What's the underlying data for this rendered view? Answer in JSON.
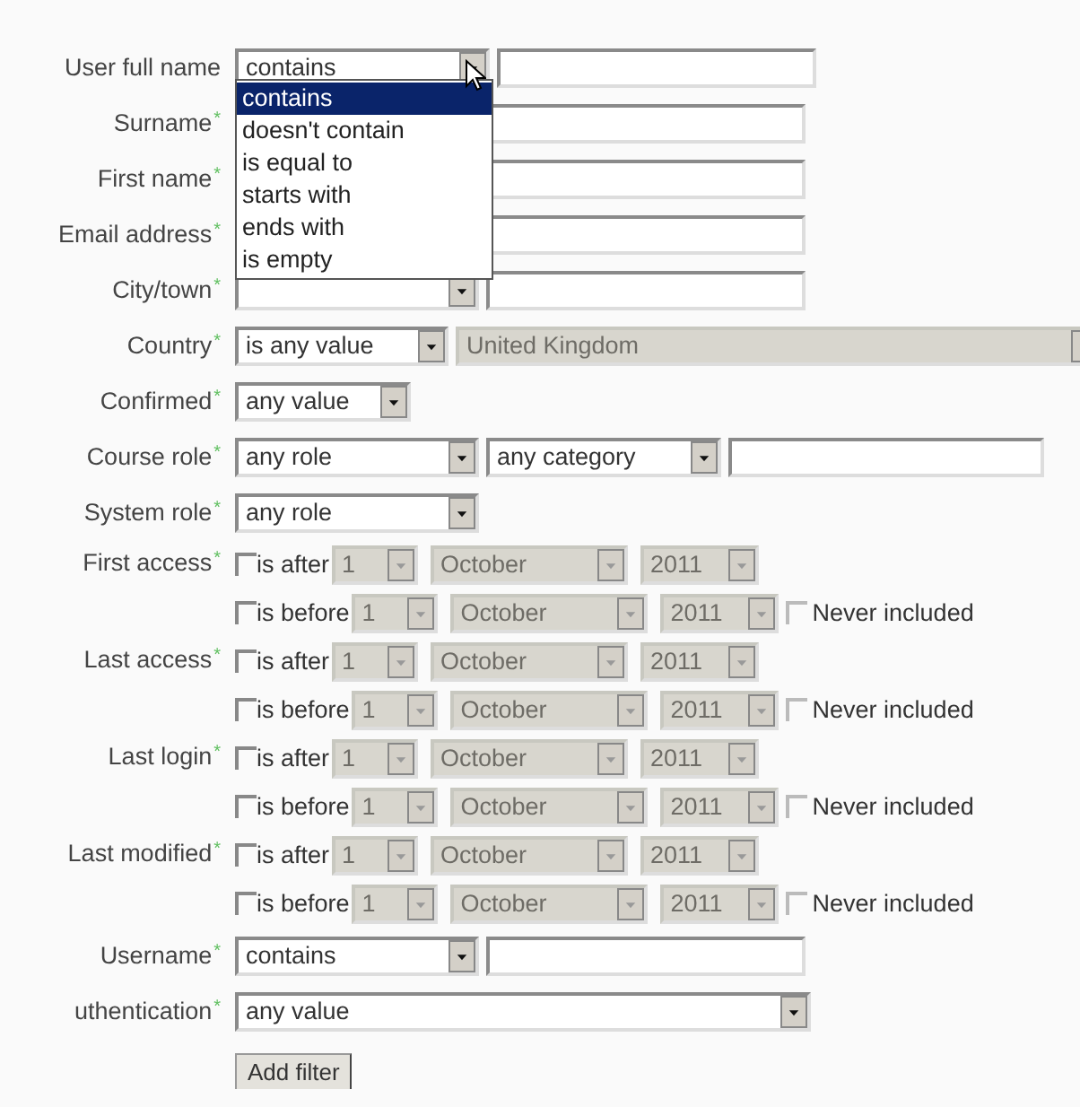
{
  "filters": [
    {
      "kind": "text",
      "label": "User full name",
      "operator": {
        "value": "contains"
      },
      "dropdown": {
        "options": [
          {
            "label": "contains",
            "selected": true
          },
          {
            "label": "doesn't contain",
            "selected": false
          },
          {
            "label": "is equal to",
            "selected": false
          },
          {
            "label": "starts with",
            "selected": false
          },
          {
            "label": "ends with",
            "selected": false
          },
          {
            "label": "is empty",
            "selected": false
          }
        ]
      }
    },
    {
      "kind": "covered",
      "label": "Surname",
      "mark": "*"
    },
    {
      "kind": "covered",
      "label": "First name",
      "mark": "*"
    },
    {
      "kind": "covered",
      "label": "Email address",
      "mark": "*"
    },
    {
      "kind": "text",
      "label": "City/town",
      "mark": "*"
    },
    {
      "kind": "country",
      "label": "Country",
      "mark": "*",
      "operator": {
        "value": "is any value"
      },
      "choice": {
        "value": "United Kingdom",
        "disabled": true
      }
    },
    {
      "kind": "select",
      "label": "Confirmed",
      "mark": "*",
      "operator": {
        "value": "any value"
      }
    },
    {
      "kind": "role",
      "label": "Course role",
      "mark": "*",
      "operator": {
        "value": "any role"
      },
      "category": {
        "value": "any category"
      }
    },
    {
      "kind": "medium",
      "label": "System role",
      "mark": "*",
      "operator": {
        "value": "any role"
      }
    },
    {
      "kind": "date",
      "label": "First access",
      "mark": "*",
      "lines": [
        {
          "label": "is after",
          "checked": false,
          "day": "1",
          "month": "October",
          "year": "2011",
          "disabled": true
        },
        {
          "label": "is before",
          "checked": false,
          "day": "1",
          "month": "October",
          "year": "2011",
          "disabled": true,
          "never_label": "Never included",
          "never_checked": false
        }
      ]
    },
    {
      "kind": "date",
      "label": "Last access",
      "mark": "*",
      "lines": [
        {
          "label": "is after",
          "checked": false,
          "day": "1",
          "month": "October",
          "year": "2011",
          "disabled": true
        },
        {
          "label": "is before",
          "checked": false,
          "day": "1",
          "month": "October",
          "year": "2011",
          "disabled": true,
          "never_label": "Never included",
          "never_checked": false
        }
      ]
    },
    {
      "kind": "date",
      "label": "Last login",
      "mark": "*",
      "lines": [
        {
          "label": "is after",
          "checked": false,
          "day": "1",
          "month": "October",
          "year": "2011",
          "disabled": true
        },
        {
          "label": "is before",
          "checked": false,
          "day": "1",
          "month": "October",
          "year": "2011",
          "disabled": true,
          "never_label": "Never included",
          "never_checked": false
        }
      ]
    },
    {
      "kind": "date",
      "label": "Last modified",
      "mark": "*",
      "lines": [
        {
          "label": "is after",
          "checked": false,
          "day": "1",
          "month": "October",
          "year": "2011",
          "disabled": true
        },
        {
          "label": "is before",
          "checked": false,
          "day": "1",
          "month": "October",
          "year": "2011",
          "disabled": true,
          "never_label": "Never included",
          "never_checked": false
        }
      ]
    },
    {
      "kind": "text",
      "label": "Username",
      "mark": "*",
      "operator": {
        "value": "contains"
      }
    },
    {
      "kind": "wide",
      "label": "uthentication",
      "mark": "*",
      "operator": {
        "value": "any value"
      }
    }
  ],
  "button": "Add filter"
}
